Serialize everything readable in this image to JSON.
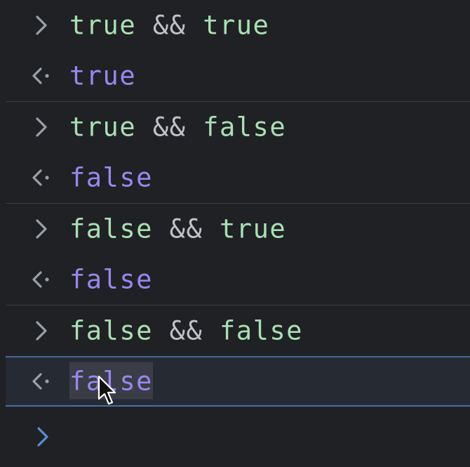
{
  "colors": {
    "background": "#202124",
    "input_keyword": "#a8e0b3",
    "operator": "#bfc2c8",
    "output_value": "#9a86f0",
    "prompt_icon": "#9aa0a6",
    "active_prompt": "#5b8bd8",
    "selection_border": "#4a6fa8"
  },
  "entries": [
    {
      "type": "input",
      "icon": "chevron-right-icon",
      "left": "true",
      "op": "&&",
      "right": "true"
    },
    {
      "type": "output",
      "icon": "return-arrow-icon",
      "value": "true"
    },
    {
      "type": "input",
      "icon": "chevron-right-icon",
      "left": "true",
      "op": "&&",
      "right": "false"
    },
    {
      "type": "output",
      "icon": "return-arrow-icon",
      "value": "false"
    },
    {
      "type": "input",
      "icon": "chevron-right-icon",
      "left": "false",
      "op": "&&",
      "right": "true"
    },
    {
      "type": "output",
      "icon": "return-arrow-icon",
      "value": "false"
    },
    {
      "type": "input",
      "icon": "chevron-right-icon",
      "left": "false",
      "op": "&&",
      "right": "false"
    },
    {
      "type": "output",
      "icon": "return-arrow-icon",
      "value": "false",
      "selected": true
    }
  ],
  "prompt": {
    "icon": "chevron-right-icon"
  }
}
